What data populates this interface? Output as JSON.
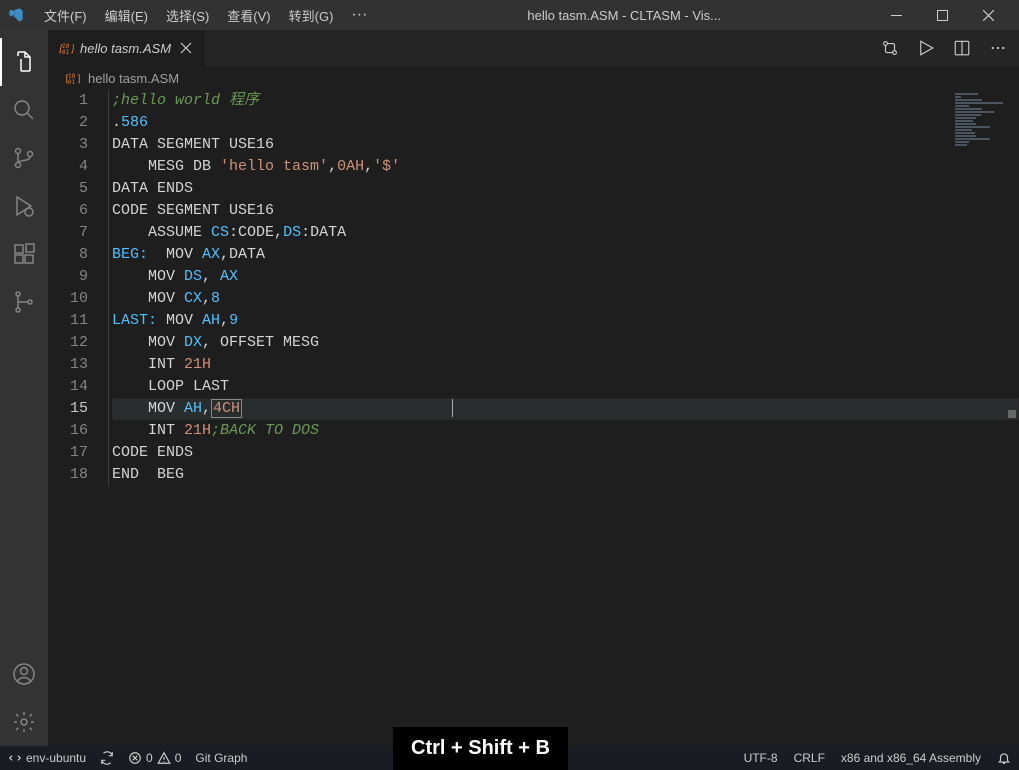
{
  "titleBar": {
    "menus": [
      "文件(F)",
      "编辑(E)",
      "选择(S)",
      "查看(V)",
      "转到(G)"
    ],
    "ellipsis": "···",
    "title": "hello tasm.ASM - CLTASM - Vis..."
  },
  "tabs": {
    "active": {
      "label": "hello tasm.ASM"
    }
  },
  "breadcrumb": {
    "label": "hello tasm.ASM"
  },
  "code": {
    "lines": [
      {
        "n": 1,
        "segs": [
          {
            "t": ";hello world 程序",
            "c": "tk-comment"
          }
        ]
      },
      {
        "n": 2,
        "segs": [
          {
            "t": ".",
            "c": "tk-kw"
          },
          {
            "t": "586",
            "c": "tk-num"
          }
        ]
      },
      {
        "n": 3,
        "segs": [
          {
            "t": "DATA SEGMENT USE16",
            "c": "tk-kw"
          }
        ],
        "noIndent": true
      },
      {
        "n": 4,
        "segs": [
          {
            "t": "    MESG DB ",
            "c": "tk-kw"
          },
          {
            "t": "'hello tasm'",
            "c": "tk-str"
          },
          {
            "t": ",",
            "c": "tk-kw"
          },
          {
            "t": "0AH",
            "c": "tk-str"
          },
          {
            "t": ",",
            "c": "tk-kw"
          },
          {
            "t": "'$'",
            "c": "tk-str"
          }
        ]
      },
      {
        "n": 5,
        "segs": [
          {
            "t": "DATA ENDS",
            "c": "tk-kw"
          }
        ],
        "noIndent": true
      },
      {
        "n": 6,
        "segs": [
          {
            "t": "CODE SEGMENT USE16",
            "c": "tk-kw"
          }
        ],
        "noIndent": true
      },
      {
        "n": 7,
        "segs": [
          {
            "t": "    ASSUME ",
            "c": "tk-kw"
          },
          {
            "t": "CS",
            "c": "tk-reg"
          },
          {
            "t": ":CODE,",
            "c": "tk-kw"
          },
          {
            "t": "DS",
            "c": "tk-reg"
          },
          {
            "t": ":DATA",
            "c": "tk-kw"
          }
        ]
      },
      {
        "n": 8,
        "segs": [
          {
            "t": "BEG:",
            "c": "tk-label"
          },
          {
            "t": "  MOV ",
            "c": "tk-kw"
          },
          {
            "t": "AX",
            "c": "tk-reg"
          },
          {
            "t": ",DATA",
            "c": "tk-kw"
          }
        ],
        "noIndent": true
      },
      {
        "n": 9,
        "segs": [
          {
            "t": "    MOV ",
            "c": "tk-kw"
          },
          {
            "t": "DS",
            "c": "tk-reg"
          },
          {
            "t": ", ",
            "c": "tk-kw"
          },
          {
            "t": "AX",
            "c": "tk-reg"
          }
        ]
      },
      {
        "n": 10,
        "segs": [
          {
            "t": "    MOV ",
            "c": "tk-kw"
          },
          {
            "t": "CX",
            "c": "tk-reg"
          },
          {
            "t": ",",
            "c": "tk-kw"
          },
          {
            "t": "8",
            "c": "tk-num"
          }
        ]
      },
      {
        "n": 11,
        "segs": [
          {
            "t": "LAST:",
            "c": "tk-label"
          },
          {
            "t": " MOV ",
            "c": "tk-kw"
          },
          {
            "t": "AH",
            "c": "tk-reg"
          },
          {
            "t": ",",
            "c": "tk-kw"
          },
          {
            "t": "9",
            "c": "tk-num"
          }
        ],
        "noIndent": true
      },
      {
        "n": 12,
        "segs": [
          {
            "t": "    MOV ",
            "c": "tk-kw"
          },
          {
            "t": "DX",
            "c": "tk-reg"
          },
          {
            "t": ", OFFSET MESG",
            "c": "tk-kw"
          }
        ]
      },
      {
        "n": 13,
        "segs": [
          {
            "t": "    INT ",
            "c": "tk-kw"
          },
          {
            "t": "21H",
            "c": "tk-str"
          }
        ]
      },
      {
        "n": 14,
        "segs": [
          {
            "t": "    LOOP LAST",
            "c": "tk-kw"
          }
        ]
      },
      {
        "n": 15,
        "segs": [
          {
            "t": "    MOV ",
            "c": "tk-kw"
          },
          {
            "t": "AH",
            "c": "tk-reg"
          },
          {
            "t": ",",
            "c": "tk-kw"
          },
          {
            "t": "4CH",
            "c": "tk-sel"
          }
        ],
        "current": true
      },
      {
        "n": 16,
        "segs": [
          {
            "t": "    INT ",
            "c": "tk-kw"
          },
          {
            "t": "21H",
            "c": "tk-str"
          },
          {
            "t": ";BACK TO DOS",
            "c": "tk-comment"
          }
        ]
      },
      {
        "n": 17,
        "segs": [
          {
            "t": "CODE ENDS",
            "c": "tk-kw"
          }
        ],
        "noIndent": true
      },
      {
        "n": 18,
        "segs": [
          {
            "t": "END  BEG",
            "c": "tk-kw"
          }
        ],
        "noIndent": true
      }
    ]
  },
  "statusBar": {
    "remote": "env-ubuntu",
    "errors": "0",
    "warnings": "0",
    "gitGraph": "Git Graph",
    "encoding": "UTF-8",
    "eol": "CRLF",
    "language": "x86 and x86_64 Assembly"
  },
  "tooltip": "Ctrl + Shift + B"
}
